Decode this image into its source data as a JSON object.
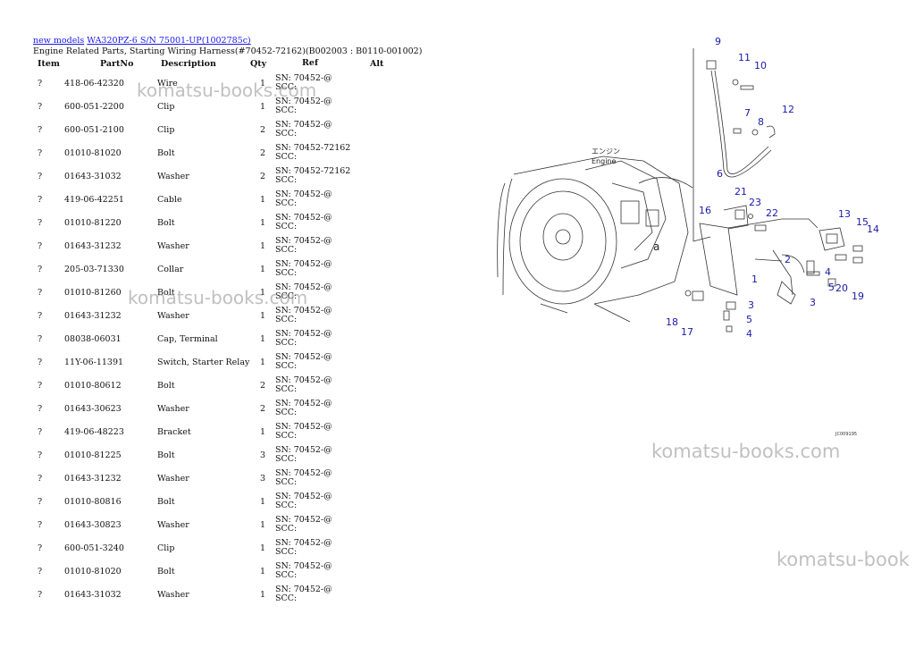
{
  "header": {
    "link_new_models": "new models",
    "link_model": "WA320PZ-6 S/N 75001-UP(1002785c)",
    "title": "Engine Related Parts, Starting Wiring Harness(#70452-72162)(B002003 : B0110-001002)"
  },
  "columns": {
    "item": "Item",
    "partno": "PartNo",
    "description": "Description",
    "qty": "Qty",
    "ref": "Ref",
    "alt": "Alt"
  },
  "rows": [
    {
      "item": "?",
      "partno": "418-06-42320",
      "description": "Wire",
      "qty": "1",
      "ref1": "SN: 70452-@",
      "ref2": "SCC:"
    },
    {
      "item": "?",
      "partno": "600-051-2200",
      "description": "Clip",
      "qty": "1",
      "ref1": "SN: 70452-@",
      "ref2": "SCC:"
    },
    {
      "item": "?",
      "partno": "600-051-2100",
      "description": "Clip",
      "qty": "2",
      "ref1": "SN: 70452-@",
      "ref2": "SCC:"
    },
    {
      "item": "?",
      "partno": "01010-81020",
      "description": "Bolt",
      "qty": "2",
      "ref1": "SN: 70452-72162",
      "ref2": "SCC:"
    },
    {
      "item": "?",
      "partno": "01643-31032",
      "description": "Washer",
      "qty": "2",
      "ref1": "SN: 70452-72162",
      "ref2": "SCC:"
    },
    {
      "item": "?",
      "partno": "419-06-42251",
      "description": "Cable",
      "qty": "1",
      "ref1": "SN: 70452-@",
      "ref2": "SCC:"
    },
    {
      "item": "?",
      "partno": "01010-81220",
      "description": "Bolt",
      "qty": "1",
      "ref1": "SN: 70452-@",
      "ref2": "SCC:"
    },
    {
      "item": "?",
      "partno": "01643-31232",
      "description": "Washer",
      "qty": "1",
      "ref1": "SN: 70452-@",
      "ref2": "SCC:"
    },
    {
      "item": "?",
      "partno": "205-03-71330",
      "description": "Collar",
      "qty": "1",
      "ref1": "SN: 70452-@",
      "ref2": "SCC:"
    },
    {
      "item": "?",
      "partno": "01010-81260",
      "description": "Bolt",
      "qty": "1",
      "ref1": "SN: 70452-@",
      "ref2": "SCC:"
    },
    {
      "item": "?",
      "partno": "01643-31232",
      "description": "Washer",
      "qty": "1",
      "ref1": "SN: 70452-@",
      "ref2": "SCC:"
    },
    {
      "item": "?",
      "partno": "08038-06031",
      "description": "Cap, Terminal",
      "qty": "1",
      "ref1": "SN: 70452-@",
      "ref2": "SCC:"
    },
    {
      "item": "?",
      "partno": "11Y-06-11391",
      "description": "Switch, Starter Relay",
      "qty": "1",
      "ref1": "SN: 70452-@",
      "ref2": "SCC:"
    },
    {
      "item": "?",
      "partno": "01010-80612",
      "description": "Bolt",
      "qty": "2",
      "ref1": "SN: 70452-@",
      "ref2": "SCC:"
    },
    {
      "item": "?",
      "partno": "01643-30623",
      "description": "Washer",
      "qty": "2",
      "ref1": "SN: 70452-@",
      "ref2": "SCC:"
    },
    {
      "item": "?",
      "partno": "419-06-48223",
      "description": "Bracket",
      "qty": "1",
      "ref1": "SN: 70452-@",
      "ref2": "SCC:"
    },
    {
      "item": "?",
      "partno": "01010-81225",
      "description": "Bolt",
      "qty": "3",
      "ref1": "SN: 70452-@",
      "ref2": "SCC:"
    },
    {
      "item": "?",
      "partno": "01643-31232",
      "description": "Washer",
      "qty": "3",
      "ref1": "SN: 70452-@",
      "ref2": "SCC:"
    },
    {
      "item": "?",
      "partno": "01010-80816",
      "description": "Bolt",
      "qty": "1",
      "ref1": "SN: 70452-@",
      "ref2": "SCC:"
    },
    {
      "item": "?",
      "partno": "01643-30823",
      "description": "Washer",
      "qty": "1",
      "ref1": "SN: 70452-@",
      "ref2": "SCC:"
    },
    {
      "item": "?",
      "partno": "600-051-3240",
      "description": "Clip",
      "qty": "1",
      "ref1": "SN: 70452-@",
      "ref2": "SCC:"
    },
    {
      "item": "?",
      "partno": "01010-81020",
      "description": "Bolt",
      "qty": "1",
      "ref1": "SN: 70452-@",
      "ref2": "SCC:"
    },
    {
      "item": "?",
      "partno": "01643-31032",
      "description": "Washer",
      "qty": "1",
      "ref1": "SN: 70452-@",
      "ref2": "SCC:"
    }
  ],
  "watermarks": {
    "wm1": "komatsu-books.com",
    "wm2": "komatsu-books.com",
    "wm3": "komatsu-books.com",
    "wm4": "komatsu-book"
  },
  "diagram": {
    "callouts": [
      "9",
      "11",
      "10",
      "7",
      "8",
      "12",
      "6",
      "21",
      "23",
      "22",
      "16",
      "13",
      "15",
      "14",
      "2",
      "4",
      "5",
      "20",
      "19",
      "1",
      "3",
      "3",
      "5",
      "4",
      "18",
      "17"
    ],
    "engine_label_jp": "エンジン",
    "engine_label": "Engine",
    "view_label": "a",
    "figure_code": "JC009195",
    "label_color": "#1a1aaa"
  }
}
